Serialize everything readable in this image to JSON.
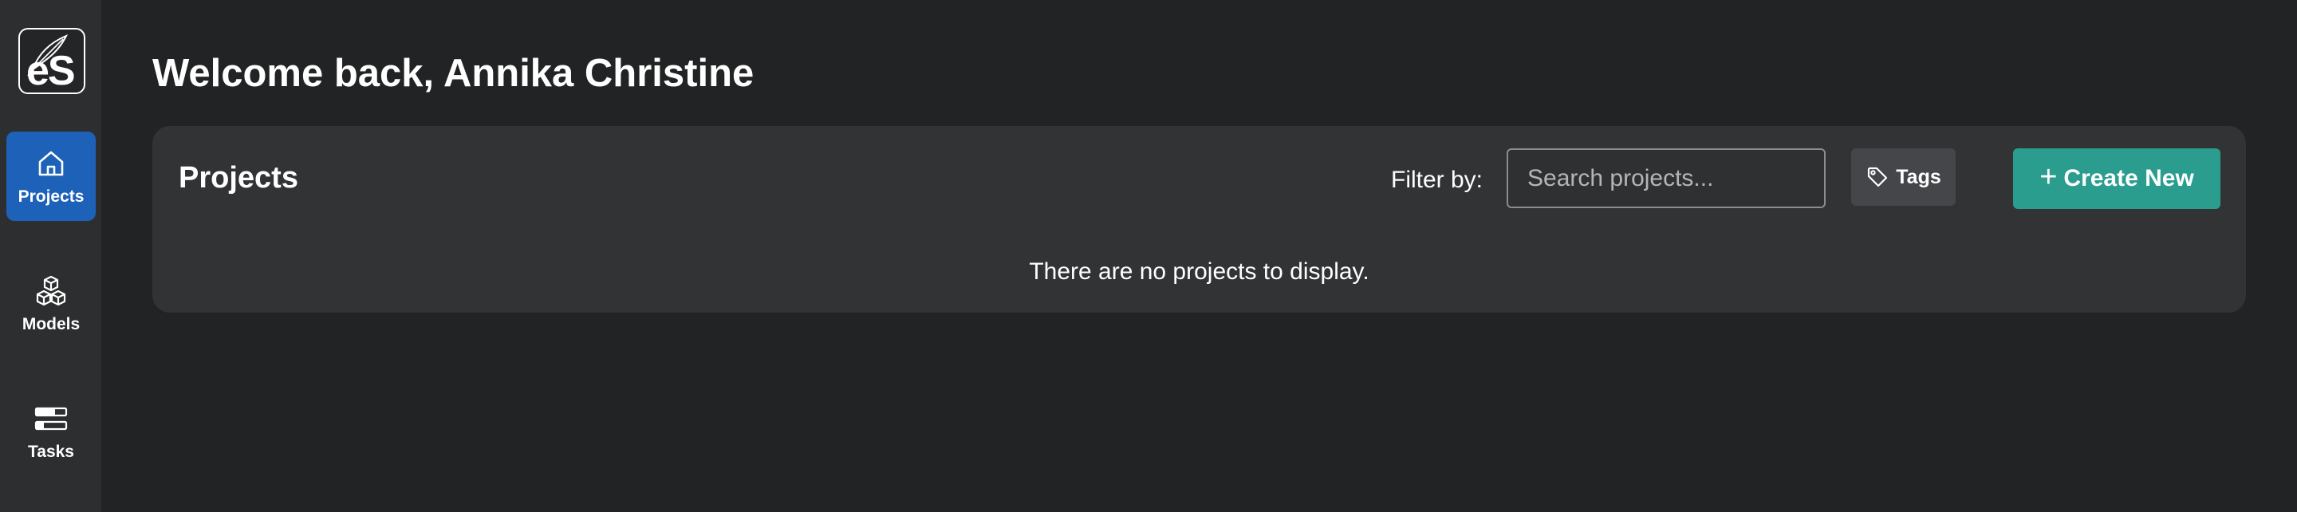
{
  "logo": {
    "text": "eS",
    "icon": "feather-icon"
  },
  "sidebar": {
    "items": [
      {
        "label": "Projects",
        "icon": "home-icon",
        "active": true
      },
      {
        "label": "Models",
        "icon": "cubes-icon",
        "active": false
      },
      {
        "label": "Tasks",
        "icon": "task-bars-icon",
        "active": false
      }
    ]
  },
  "header": {
    "title": "Welcome back, Annika Christine"
  },
  "projects": {
    "title": "Projects",
    "filter_label": "Filter by:",
    "search_placeholder": "Search projects...",
    "search_value": "",
    "tags_label": "Tags",
    "create_label": "Create New",
    "create_icon": "plus-icon",
    "empty_message": "There are no projects to display."
  },
  "colors": {
    "background": "#222324",
    "sidebar": "#2d2e30",
    "card": "#323335",
    "active_nav": "#1d62b8",
    "primary_button": "#2a9d8f",
    "tags_button": "#45464a"
  }
}
